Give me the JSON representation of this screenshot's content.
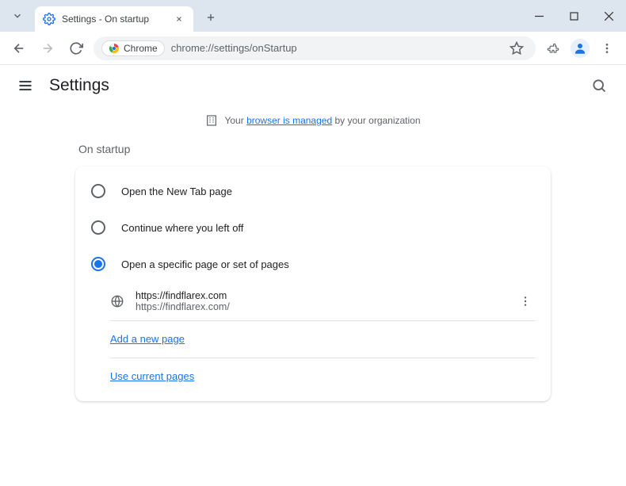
{
  "window": {
    "tab_title": "Settings - On startup"
  },
  "toolbar": {
    "chrome_chip": "Chrome",
    "url": "chrome://settings/onStartup"
  },
  "settings": {
    "title": "Settings",
    "banner_prefix": "Your ",
    "banner_link": "browser is managed",
    "banner_suffix": " by your organization",
    "section_label": "On startup",
    "options": {
      "new_tab": "Open the New Tab page",
      "continue": "Continue where you left off",
      "specific": "Open a specific page or set of pages"
    },
    "startup_page": {
      "title": "https://findflarex.com",
      "url": "https://findflarex.com/"
    },
    "add_page": "Add a new page",
    "use_current": "Use current pages"
  }
}
